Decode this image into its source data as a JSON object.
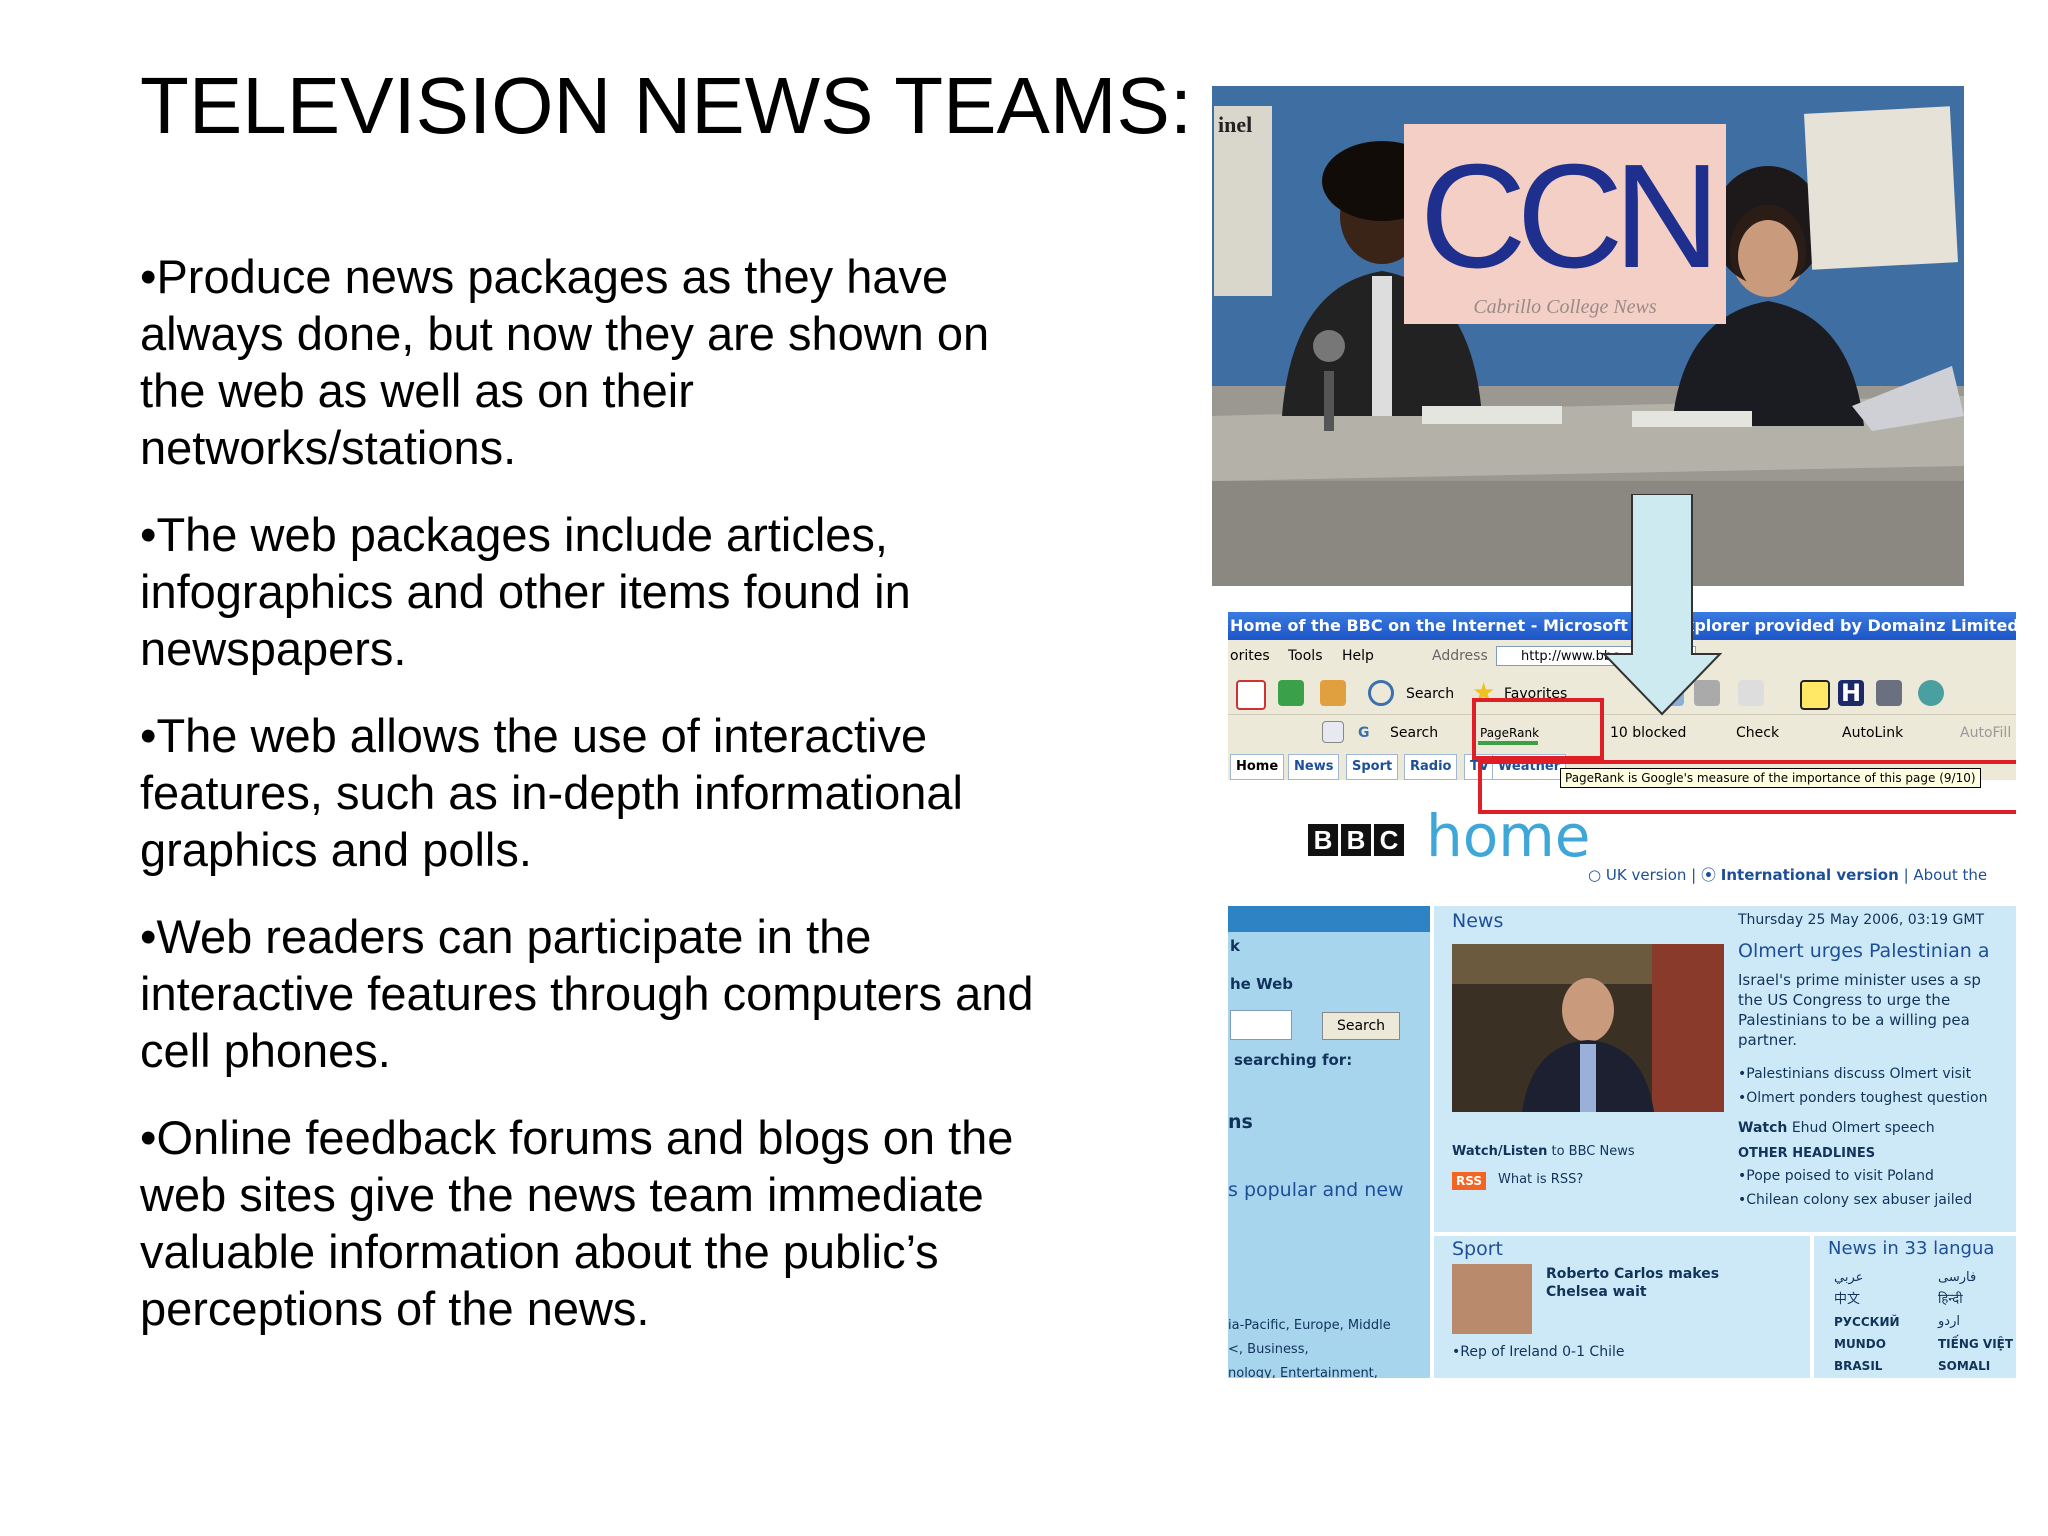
{
  "slide": {
    "title": "TELEVISION NEWS TEAMS:",
    "bullets": [
      "•Produce news packages as they have always done, but now they are shown on the web as well as on their networks/stations.",
      "•The web packages include articles, infographics and other items found in newspapers.",
      "•The web allows the use of interactive features, such as in-depth informational graphics and polls.",
      "•Web readers can participate in the interactive features through computers and cell phones.",
      "•Online feedback forums and blogs on the web sites give the news team immediate valuable information about the public’s perceptions of the news."
    ]
  },
  "tv_photo": {
    "logo": "CCN",
    "subtitle": "Cabrillo College News",
    "paper_text": "inel"
  },
  "browser": {
    "title_left": "Home of the BBC on the Internet - Microsoft Inte",
    "title_right": "xplorer provided by Domainz Limited",
    "menu": [
      "orites",
      "Tools",
      "Help"
    ],
    "address_label": "Address",
    "address_value": "http://www.bbc",
    "toolbar_search": "Search",
    "toolbar_favorites": "Favorites",
    "google_search": "Search",
    "pagerank": "PageRank",
    "blocked": "10 blocked",
    "check": "Check",
    "autolink": "AutoLink",
    "autofill": "AutoFill",
    "tabs": [
      "Home",
      "News",
      "Sport",
      "Radio",
      "TV",
      "Weather"
    ],
    "tooltip": "PageRank is Google's measure of the importance of this page (9/10)",
    "bbc_letters": [
      "B",
      "B",
      "C"
    ],
    "home_word": "home",
    "uk_version": "UK version",
    "intl_version": "International version",
    "about": "About the",
    "left_col": {
      "k": "k",
      "web": "he Web",
      "search_btn": "Search",
      "searching": "searching for:",
      "ns": "ns",
      "popular": "s popular and new",
      "regions": "ia-Pacific, Europe, Middle",
      "regions2": "<, Business,",
      "regions3": "nology, Entertainment,"
    },
    "news": {
      "heading": "News",
      "date": "Thursday 25 May 2006, 03:19 GMT",
      "headline": "Olmert urges Palestinian a",
      "body": [
        "Israel's prime minister uses a sp",
        "the US Congress to urge the",
        "Palestinians to be a willing pea",
        "partner."
      ],
      "links": [
        "•Palestinians discuss Olmert visit",
        "•Olmert ponders toughest question"
      ],
      "watch_label": "Watch",
      "watch": "Ehud Olmert speech",
      "watch_listen": "Watch/Listen",
      "watch_listen_rest": "to BBC News",
      "rss": "RSS",
      "what_rss": "What is RSS?",
      "other_headlines": "OTHER HEADLINES",
      "other": [
        "•Pope poised to visit Poland",
        "•Chilean colony sex abuser jailed"
      ]
    },
    "sport": {
      "heading": "Sport",
      "headline1": "Roberto Carlos makes",
      "headline2": "Chelsea wait",
      "link": "•Rep of Ireland 0-1 Chile"
    },
    "languages": {
      "heading": "News in 33 langua",
      "items": [
        "عربي",
        "فارسی",
        "中文",
        "हिन्दी",
        "РУССКИЙ",
        "اردو",
        "MUNDO",
        "TIẾNG VIỆT",
        "BRASIL",
        "SOMALI"
      ]
    }
  }
}
